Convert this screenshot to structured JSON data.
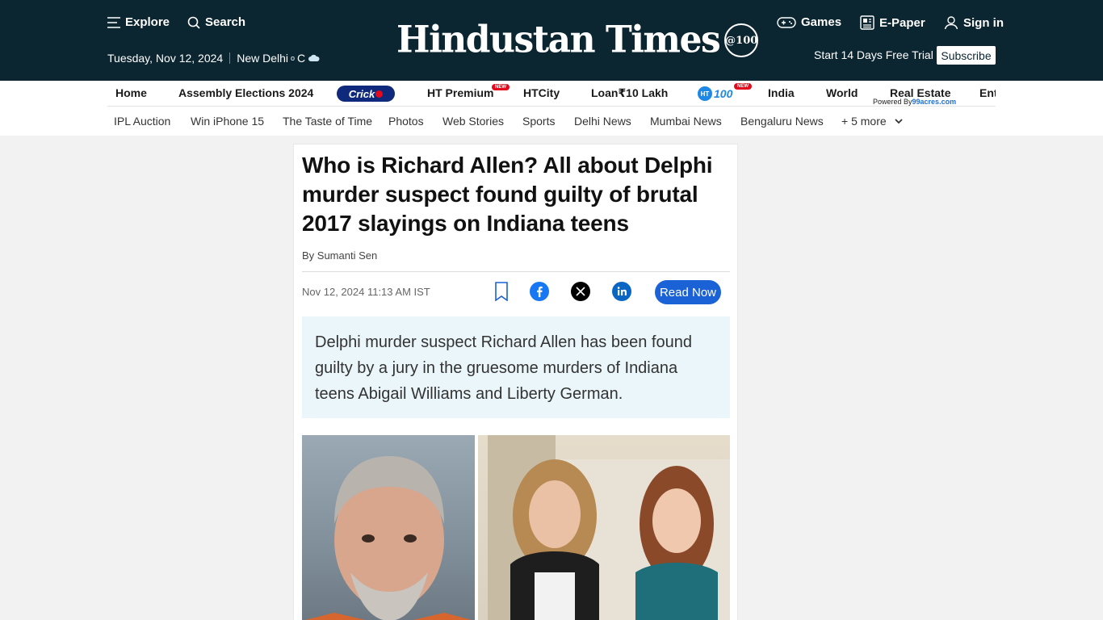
{
  "header": {
    "explore_label": "Explore",
    "search_label": "Search",
    "date": "Tuesday, Nov 12, 2024",
    "city": "New Delhi",
    "temp_unit": "C",
    "logo_text": "Hindustan Times",
    "logo_badge": "@100",
    "games_label": "Games",
    "epaper_label": "E-Paper",
    "signin_label": "Sign in",
    "trial_text": "Start 14 Days Free Trial",
    "subscribe_label": "Subscribe"
  },
  "primary_nav": {
    "home": "Home",
    "elections": "Assembly Elections 2024",
    "crickit": "Crick",
    "premium": "HT Premium",
    "new_badge": "NEW",
    "htcity": "HTCity",
    "loan": "Loan₹10 Lakh",
    "ht100_circle": "HT",
    "ht100_num": "100",
    "india": "India",
    "world": "World",
    "real_estate": "Real Estate",
    "powered_by": "Powered By",
    "powered_brand": "99acres.com",
    "ent": "Ent"
  },
  "secondary_nav": {
    "items": [
      "IPL Auction",
      "Win iPhone 15",
      "The Taste of Time",
      "Photos",
      "Web Stories",
      "Sports",
      "Delhi News",
      "Mumbai News",
      "Bengaluru News"
    ],
    "more": "+ 5 more"
  },
  "article": {
    "headline": "Who is Richard Allen? All about Delphi murder suspect found guilty of brutal 2017 slayings on Indiana teens",
    "byline": "By Sumanti Sen",
    "dateline": "Nov 12, 2024 11:13 AM IST",
    "read_now": "Read Now",
    "summary": "Delphi murder suspect Richard Allen has been found guilty by a jury in the gruesome murders of Indiana teens Abigail Williams and Liberty German."
  },
  "colors": {
    "header_bg": "#0c2631",
    "accent_blue": "#1a62d6",
    "summary_bg": "#eaf6fa",
    "new_badge": "#e4091b"
  }
}
